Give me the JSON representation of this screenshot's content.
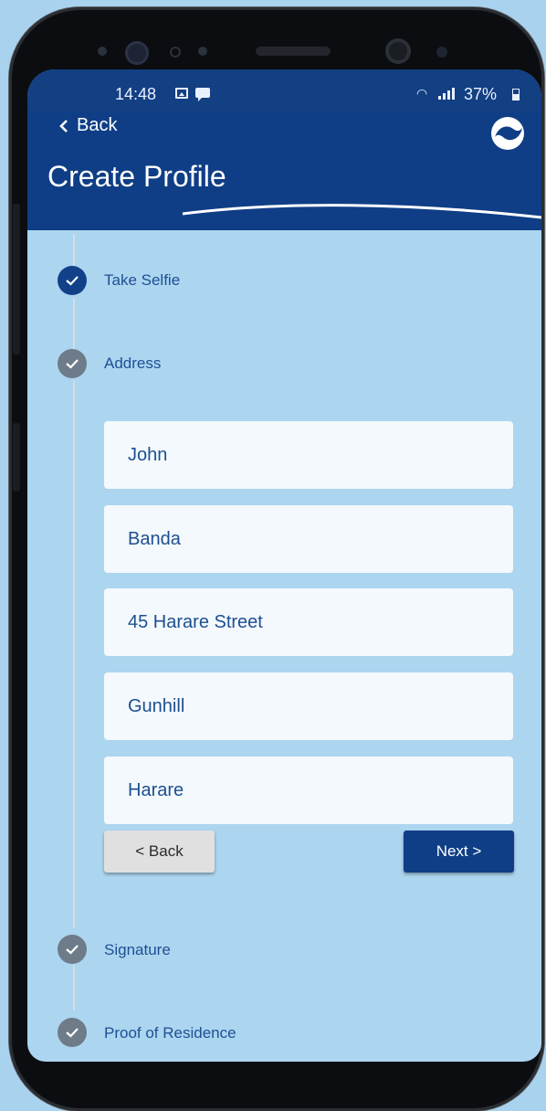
{
  "status_bar": {
    "time": "14:48",
    "battery": "37%",
    "icons": [
      "image-icon",
      "chat-icon",
      "wifi-icon",
      "signal-icon",
      "battery-icon"
    ]
  },
  "header": {
    "back_label": "Back",
    "title": "Create Profile",
    "logo": "brand-logo-icon"
  },
  "steps": [
    {
      "label": "Take Selfie",
      "state": "done"
    },
    {
      "label": "Address",
      "state": "checked"
    },
    {
      "label": "Signature",
      "state": "checked"
    },
    {
      "label": "Proof of Residence",
      "state": "checked"
    }
  ],
  "form": {
    "first_name": "John",
    "last_name": "Banda",
    "street": "45 Harare Street",
    "suburb": "Gunhill",
    "city": "Harare"
  },
  "buttons": {
    "back": "< Back",
    "next": "Next >"
  },
  "colors": {
    "primary": "#0f3e86",
    "background": "#acd5ef",
    "field": "#f4f9fd",
    "step_inactive": "#6e7b89"
  }
}
